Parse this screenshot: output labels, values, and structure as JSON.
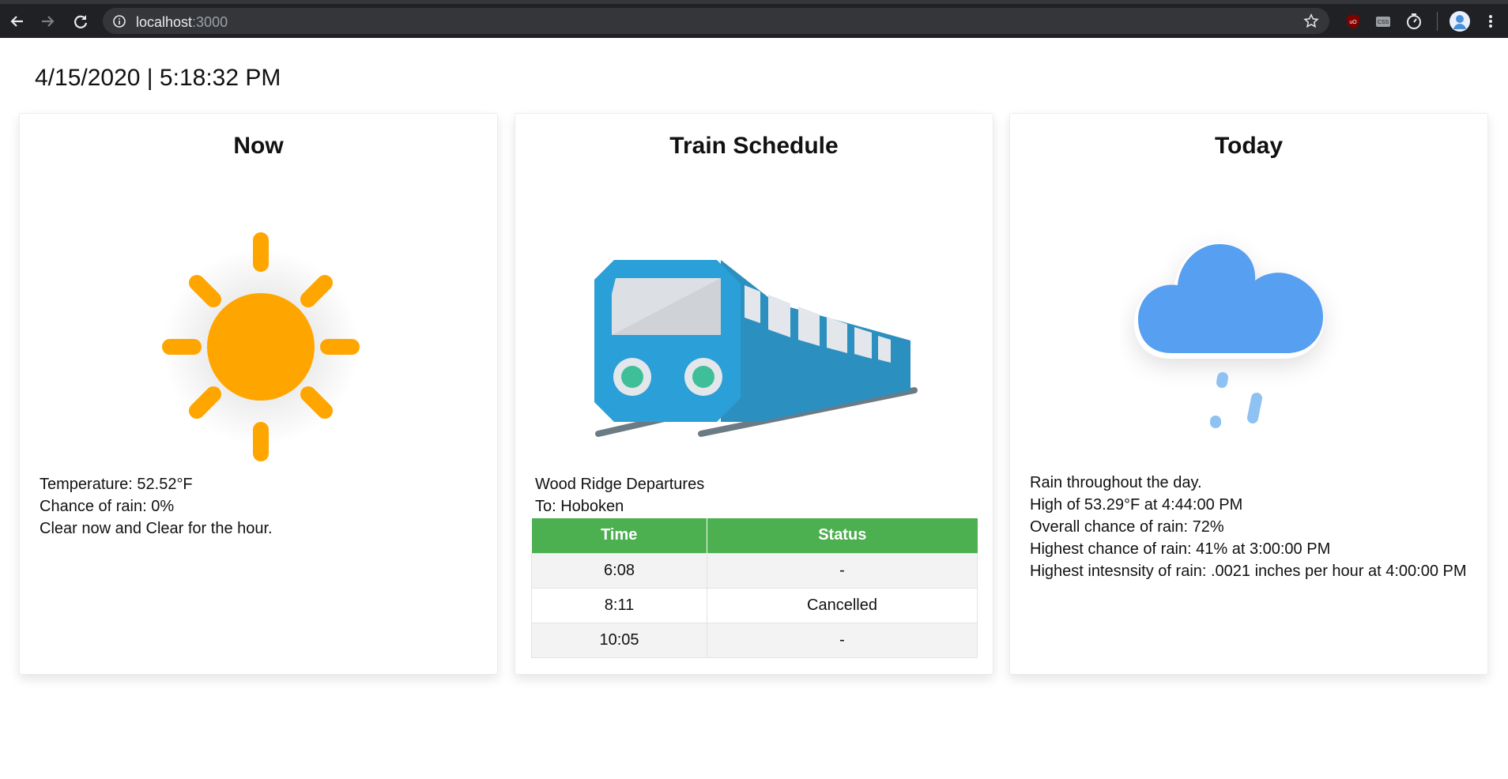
{
  "browser": {
    "url_host": "localhost",
    "url_port": ":3000",
    "icons": [
      "back-icon",
      "forward-icon",
      "reload-icon",
      "info-icon",
      "star-icon",
      "ublock-icon",
      "css-extension-icon",
      "timer-icon",
      "profile-avatar",
      "menu-icon"
    ]
  },
  "datetime": "4/15/2020 | 5:18:32 PM",
  "now": {
    "title": "Now",
    "icon": "sun-icon",
    "lines": [
      "Temperature: 52.52°F",
      "Chance of rain: 0%",
      "Clear now and Clear for the hour."
    ]
  },
  "train": {
    "title": "Train Schedule",
    "icon": "train-icon",
    "departures": "Wood Ridge Departures",
    "destination": "To: Hoboken",
    "columns": [
      "Time",
      "Status"
    ],
    "rows": [
      {
        "time": "6:08",
        "status": "-"
      },
      {
        "time": "8:11",
        "status": "Cancelled"
      },
      {
        "time": "10:05",
        "status": "-"
      }
    ]
  },
  "today": {
    "title": "Today",
    "icon": "rain-cloud-icon",
    "lines": [
      "Rain throughout the day.",
      "High of 53.29°F at 4:44:00 PM",
      "Overall chance of rain: 72%",
      "Highest chance of rain: 41% at 3:00:00 PM",
      "Highest intesnsity of rain: .0021 inches per hour at 4:00:00 PM"
    ]
  },
  "colors": {
    "sun": "#ffa500",
    "train_blue": "#2a9fd8",
    "train_dark": "#2b8fbf",
    "cloud": "#579ff0",
    "rain_drop": "#8ec2f3",
    "table_header": "#4caf50"
  }
}
